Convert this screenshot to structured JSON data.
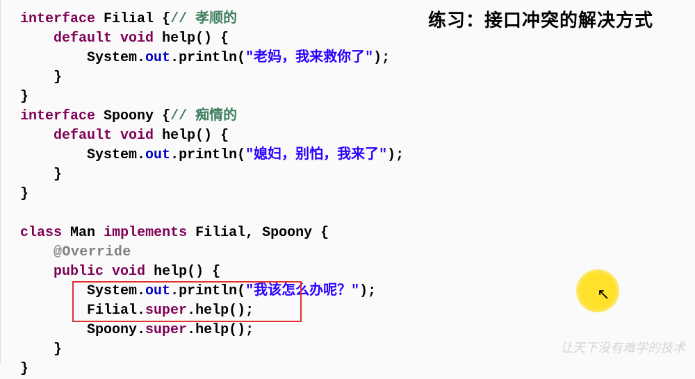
{
  "title": "练习：接口冲突的解决方式",
  "watermark": "让天下没有难学的技术",
  "code": {
    "interface1_name": "Filial",
    "interface1_comment": "// 孝顺的",
    "interface2_name": "Spoony",
    "interface2_comment": "// 痴情的",
    "method_name": "help",
    "class_name": "Man",
    "implements_list": "Filial, Spoony",
    "annotation": "@Override",
    "string1": "\"老妈，我来救你了\"",
    "string2": "\"媳妇，别怕，我来了\"",
    "string3": "\"我该怎么办呢？\"",
    "super_call1": "Filial",
    "super_call2": "Spoony",
    "kw_interface": "interface",
    "kw_default": "default",
    "kw_void": "void",
    "kw_class": "class",
    "kw_implements": "implements",
    "kw_public": "public",
    "kw_super": "super",
    "sys": "System",
    "out": "out",
    "println": "println"
  }
}
